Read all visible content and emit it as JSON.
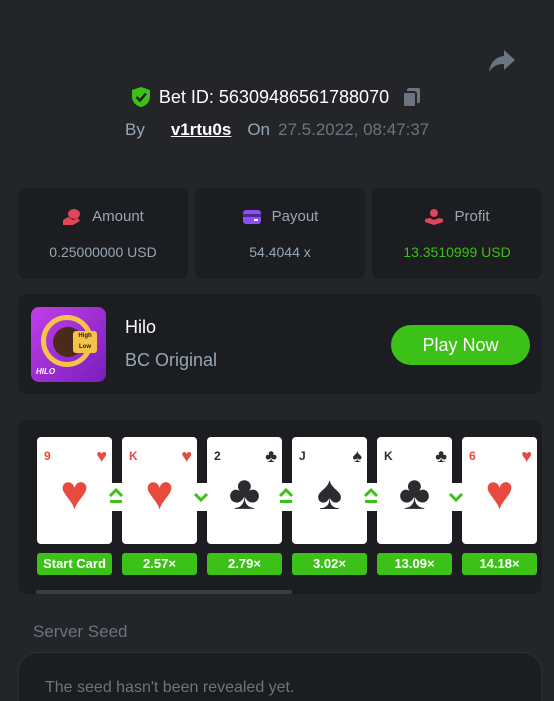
{
  "header": {
    "share_icon": "share-icon",
    "bet_id_text": "Bet ID: 56309486561788070",
    "by_label": "By",
    "username": "v1rtu0s",
    "on_label": "On",
    "date": "27.5.2022, 08:47:37"
  },
  "stats": {
    "amount": {
      "label": "Amount",
      "value": "0.25000000 USD",
      "icon": "coins-icon"
    },
    "payout": {
      "label": "Payout",
      "value": "54.4044 x",
      "icon": "wallet-icon"
    },
    "profit": {
      "label": "Profit",
      "value": "13.3510999 USD",
      "icon": "hand-coin-icon"
    }
  },
  "game": {
    "thumb_title": "HILO",
    "thumb_tag_high": "High",
    "thumb_tag_low": "Low",
    "name": "Hilo",
    "subtitle": "BC Original",
    "play_label": "Play Now"
  },
  "cards": [
    {
      "rank": "9",
      "suit": "♥",
      "color": "#e84a3d",
      "multiplier": "Start Card"
    },
    {
      "rank": "K",
      "suit": "♥",
      "color": "#e84a3d",
      "multiplier": "2.57×"
    },
    {
      "rank": "2",
      "suit": "♣",
      "color": "#2a2c30",
      "multiplier": "2.79×"
    },
    {
      "rank": "J",
      "suit": "♠",
      "color": "#2a2c30",
      "multiplier": "3.02×"
    },
    {
      "rank": "K",
      "suit": "♣",
      "color": "#2a2c30",
      "multiplier": "13.09×"
    },
    {
      "rank": "6",
      "suit": "♥",
      "color": "#e84a3d",
      "multiplier": "14.18×"
    }
  ],
  "guesses": [
    "higher",
    "lower",
    "higher",
    "higher",
    "lower"
  ],
  "seed": {
    "label": "Server Seed",
    "text": "The seed hasn't been revealed yet."
  },
  "colors": {
    "accent_green": "#3bc117",
    "background": "#232528",
    "panel": "#1b1d20"
  }
}
